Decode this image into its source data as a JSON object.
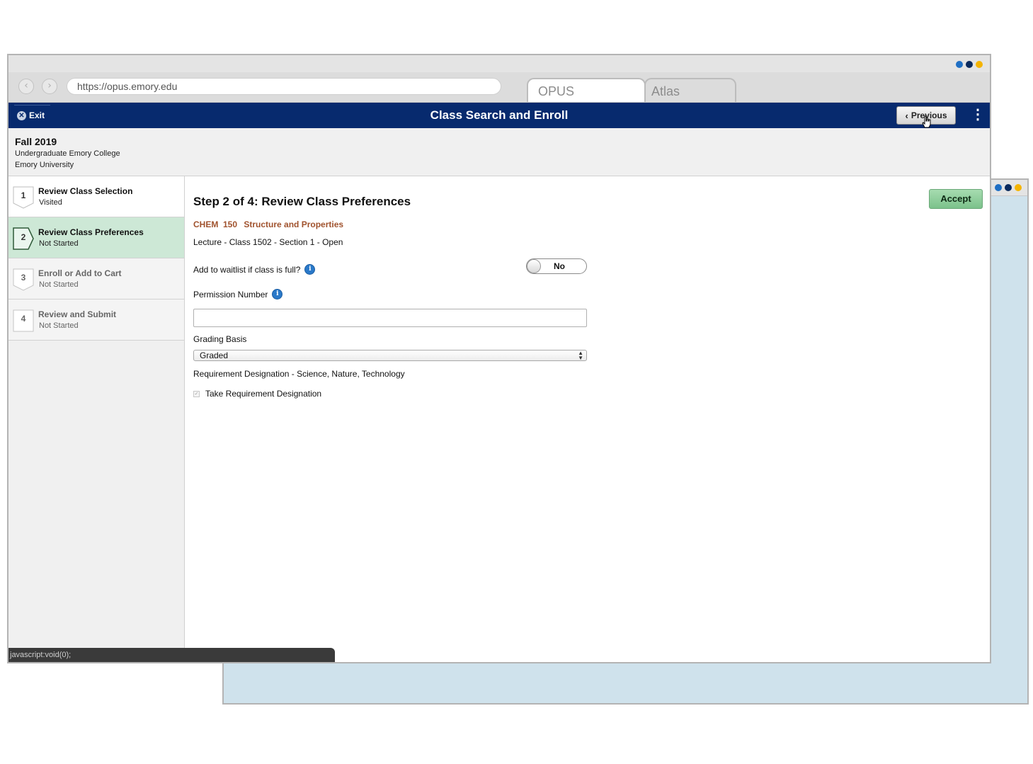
{
  "window_controls": {
    "colors": [
      "#1f6fc4",
      "#0a2a5e",
      "#f4b400"
    ]
  },
  "browser": {
    "back_icon": "chevron-left-icon",
    "forward_icon": "chevron-right-icon",
    "url": "https://opus.emory.edu",
    "tabs": [
      {
        "label": "OPUS",
        "active": true
      },
      {
        "label": "Atlas",
        "active": false
      }
    ]
  },
  "header": {
    "exit_label": "Exit",
    "title": "Class Search and Enroll",
    "previous_label": "Previous",
    "menu_icon": "kebab-menu-icon",
    "bg_color": "#072a6e"
  },
  "term": {
    "title": "Fall 2019",
    "career": "Undergraduate Emory College",
    "institution": "Emory University"
  },
  "steps": [
    {
      "number": "1",
      "label": "Review Class Selection",
      "status": "Visited"
    },
    {
      "number": "2",
      "label": "Review Class Preferences",
      "status": "Not Started"
    },
    {
      "number": "3",
      "label": "Enroll or Add to Cart",
      "status": "Not Started"
    },
    {
      "number": "4",
      "label": "Review and Submit",
      "status": "Not Started"
    }
  ],
  "main": {
    "heading": "Step 2 of 4: Review Class Preferences",
    "accept_label": "Accept",
    "course_code": "CHEM  150",
    "course_name": "Structure and Properties",
    "class_info": "Lecture - Class 1502 - Section 1 - Open",
    "waitlist_label": "Add to waitlist if class is full?",
    "waitlist_value": "No",
    "permission_label": "Permission Number",
    "permission_value": "",
    "grading_label": "Grading Basis",
    "grading_value": "Graded",
    "requirement_text": "Requirement Designation - Science, Nature, Technology",
    "take_requirement_label": "Take Requirement Designation",
    "take_requirement_checked": true
  },
  "status_bar": {
    "text": "javascript:void(0);"
  }
}
